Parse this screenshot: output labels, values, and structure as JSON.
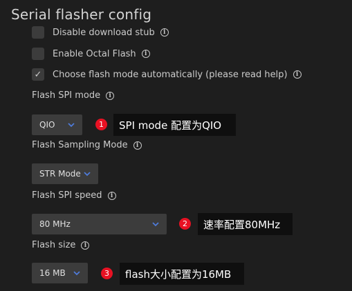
{
  "title": "Serial flasher config",
  "checkboxes": [
    {
      "label": "Disable download stub",
      "checked": false
    },
    {
      "label": "Enable Octal Flash",
      "checked": false
    },
    {
      "label": "Choose flash mode automatically (please read help)",
      "checked": true,
      "check_glyph": "✓"
    }
  ],
  "info_glyph": "i",
  "spi_mode": {
    "label": "Flash SPI mode",
    "value": "QIO"
  },
  "sampling_mode": {
    "label": "Flash Sampling Mode",
    "value": "STR Mode"
  },
  "spi_speed": {
    "label": "Flash SPI speed",
    "value": "80 MHz"
  },
  "flash_size": {
    "label": "Flash size",
    "value": "16 MB"
  },
  "annotations": [
    {
      "number": "1",
      "text": "SPI mode 配置为QIO"
    },
    {
      "number": "2",
      "text": "速率配置80MHz"
    },
    {
      "number": "3",
      "text": "flash大小配置为16MB"
    }
  ],
  "colors": {
    "badge": "#e81123",
    "chevron": "#4f7bd9",
    "background": "#1e1e1e"
  }
}
